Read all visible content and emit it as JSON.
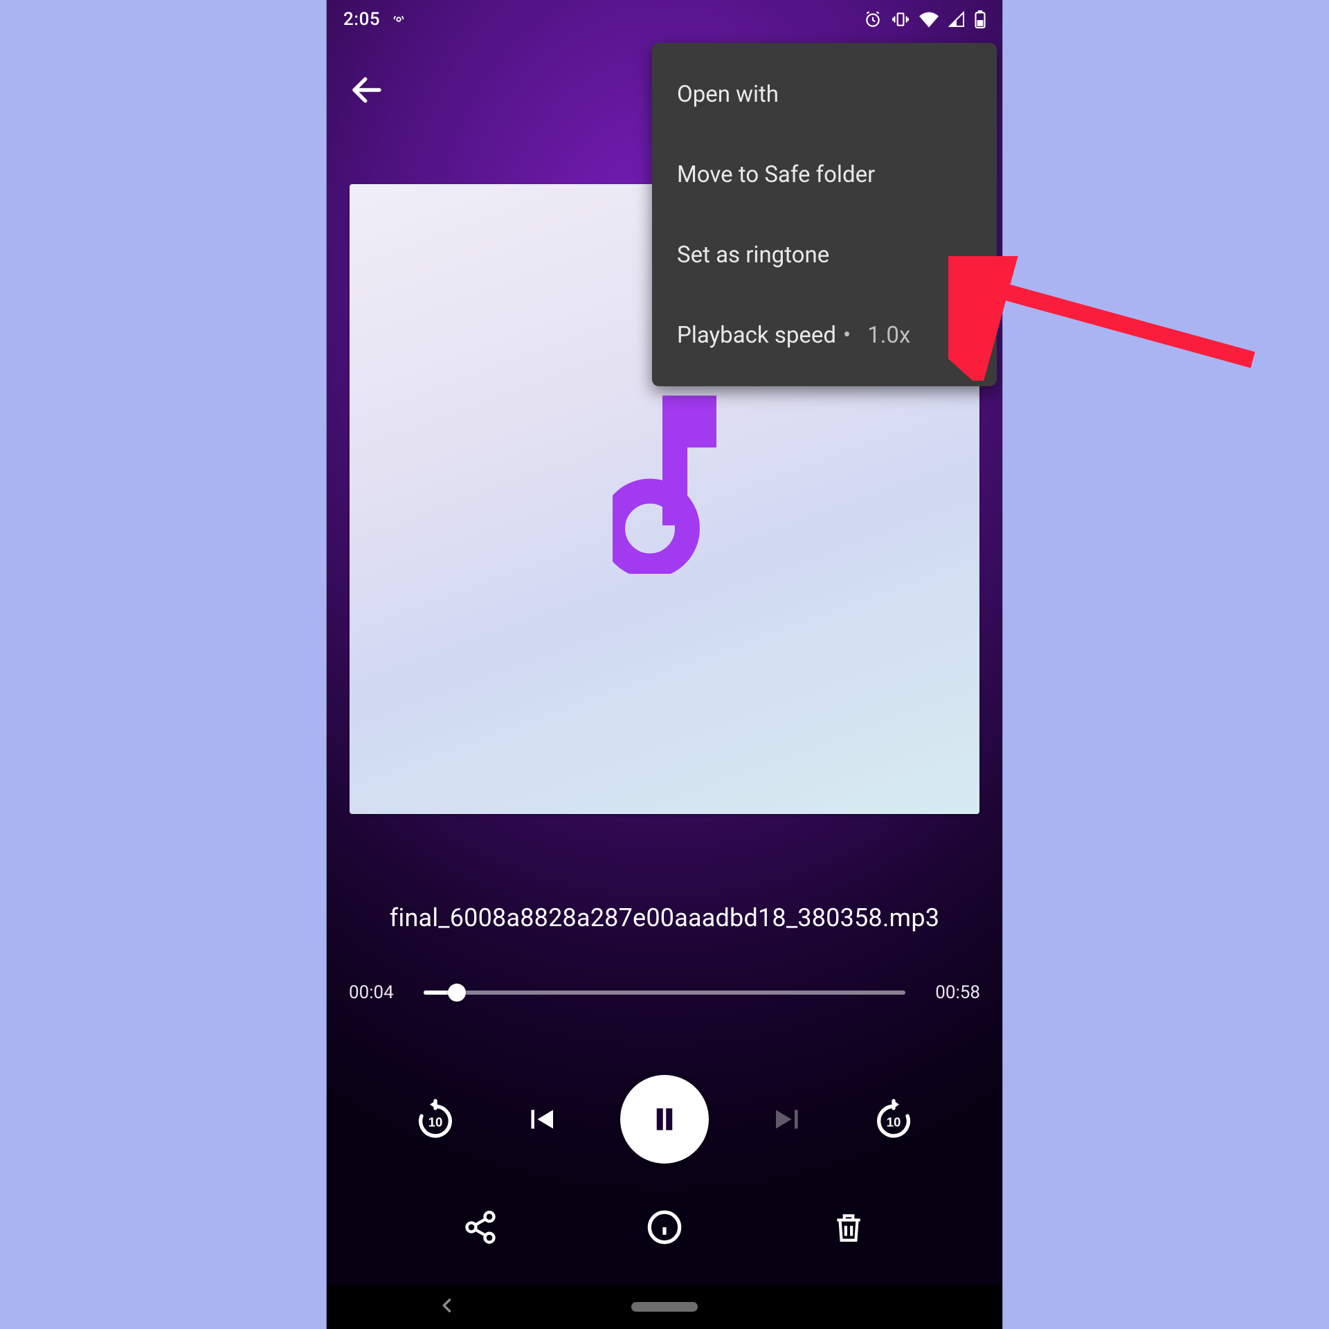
{
  "statusbar": {
    "time": "2:05",
    "hotspot_icon": "hotspot-icon",
    "alarm_icon": "alarm-icon",
    "vibrate_icon": "vibrate-icon",
    "wifi_icon": "wifi-icon",
    "cell_icon": "cell-signal-icon",
    "battery_icon": "battery-icon"
  },
  "header": {
    "back_icon": "back-icon"
  },
  "overflow_menu": {
    "items": [
      {
        "label": "Open with"
      },
      {
        "label": "Move to Safe folder"
      },
      {
        "label": "Set as ringtone"
      },
      {
        "label": "Playback speed",
        "value": "1.0x"
      }
    ]
  },
  "player": {
    "album_art_icon": "music-note-icon",
    "title": "final_6008a8828a287e00aaadbd18_380358.mp3",
    "position_label": "00:04",
    "duration_label": "00:58",
    "position_seconds": 4,
    "duration_seconds": 58,
    "progress_percent": 6.9,
    "is_playing": true
  },
  "controls": {
    "replay10_icon": "replay-10-icon",
    "prev_icon": "skip-previous-icon",
    "pause_icon": "pause-icon",
    "next_icon": "skip-next-icon",
    "forward10_icon": "forward-10-icon",
    "prev_enabled": true,
    "next_enabled": false
  },
  "actions": {
    "share_icon": "share-icon",
    "info_icon": "info-icon",
    "delete_icon": "delete-icon"
  },
  "sysnav": {
    "back_icon": "system-back-icon",
    "home_icon": "system-home-pill"
  },
  "annotation": {
    "target": "Set as ringtone"
  },
  "colors": {
    "accent_purple": "#a23af0",
    "bg_page": "#aab4f2",
    "menu_bg": "#3b3b3b",
    "arrow": "#fa1e3c"
  }
}
